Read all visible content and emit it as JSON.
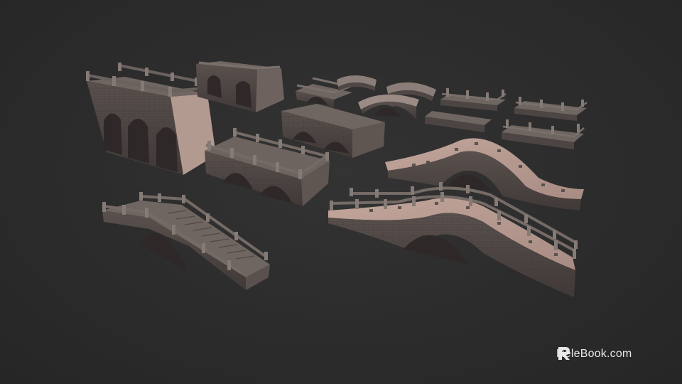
{
  "scene": {
    "background": "#2b2b2b",
    "stone_top": "#6f6661",
    "stone_side": "#4d4543",
    "stone_dark": "#3a3433",
    "stone_light": "#b49a91",
    "assets": [
      "three-arch-gate-wall",
      "gate-tower-piece",
      "small-arched-bridge",
      "short-arch-bridge",
      "curved-walkway-piece",
      "railing-segment",
      "flat-bridge-deck",
      "double-arch-flat-bridge",
      "stair-arch-bridge",
      "long-arch-ramp-bridge",
      "single-arch-hump-bridge"
    ]
  },
  "watermark": {
    "logo_letter": "R",
    "text": "ReleBook.com",
    "color": "#e8e8e8"
  }
}
